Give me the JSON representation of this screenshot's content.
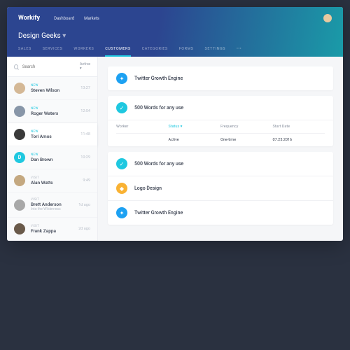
{
  "brand": "Workify",
  "topnav": {
    "dashboard": "Dashboard",
    "markets": "Markets"
  },
  "page_title": "Design Geeks",
  "tabs": {
    "sales": "SALES",
    "services": "SERVICES",
    "workers": "WORKERS",
    "customers": "CUSTOMERS",
    "categories": "CATEGORIES",
    "forms": "FORMS",
    "settings": "SETTINGS",
    "more": "•••"
  },
  "search": {
    "placeholder": "Search",
    "filter": "Active ▾"
  },
  "labels": {
    "new": "NEW",
    "visit": "VISIT"
  },
  "customers": [
    {
      "name": "Steven Wilson",
      "time": "13:27",
      "tag": "new"
    },
    {
      "name": "Roger Waters",
      "time": "12:54",
      "tag": "new"
    },
    {
      "name": "Tori Amos",
      "time": "11:48",
      "tag": "new"
    },
    {
      "name": "Dan Brown",
      "time": "10:29",
      "tag": "new",
      "letter": "D"
    },
    {
      "name": "Alan Watts",
      "time": "9:49",
      "tag": "visit"
    },
    {
      "name": "Brett Anderson",
      "sub": "Into the Wilderness",
      "time": "1d ago",
      "tag": "visit"
    },
    {
      "name": "Frank Zappa",
      "time": "2d ago",
      "tag": "visit"
    }
  ],
  "services": [
    {
      "title": "Twitter Growth Engine",
      "icon": "tw"
    },
    {
      "title": "500 Words for any use",
      "icon": "chk",
      "expanded": true
    },
    {
      "title": "500 Words for any use",
      "icon": "chk"
    },
    {
      "title": "Logo Design",
      "icon": "logo"
    },
    {
      "title": "Twitter Growth Engine",
      "icon": "tw"
    }
  ],
  "table": {
    "headers": {
      "worker": "Worker",
      "status": "Status ▾",
      "frequency": "Frequency",
      "start": "Start Date"
    },
    "row": {
      "worker": "",
      "status": "Active",
      "frequency": "One-time",
      "start": "07.25.2016"
    }
  }
}
